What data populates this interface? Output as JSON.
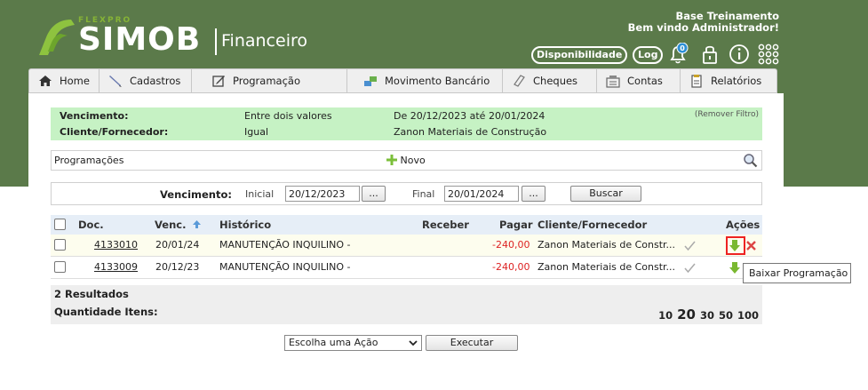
{
  "header": {
    "logo_sub": "FLEXPRO",
    "logo_main": "SIMOB",
    "logo_module": "Financeiro",
    "welcome_line1": "Base Treinamento",
    "welcome_line2": "Bem vindo Administrador!",
    "disponibilidade_label": "Disponibilidade",
    "log_label": "Log",
    "notification_count": "0"
  },
  "nav": [
    {
      "label": "Home",
      "icon": "home-icon"
    },
    {
      "label": "Cadastros",
      "icon": "pencil-icon"
    },
    {
      "label": "Programação",
      "icon": "edit-icon"
    },
    {
      "label": "Movimento Bancário",
      "icon": "bank-transfer-icon"
    },
    {
      "label": "Cheques",
      "icon": "cheque-icon"
    },
    {
      "label": "Contas",
      "icon": "accounts-icon"
    },
    {
      "label": "Relatórios",
      "icon": "report-icon"
    }
  ],
  "filter": {
    "label1": "Vencimento:",
    "op1": "Entre dois valores",
    "val1": "De 20/12/2023 até 20/01/2024",
    "label2": "Cliente/Fornecedor:",
    "op2": "Igual",
    "val2": "Zanon Materiais de Construção",
    "remove": "(Remover Filtro)"
  },
  "programacoes": {
    "title": "Programações",
    "novo": "Novo"
  },
  "search": {
    "label": "Vencimento:",
    "inicial_label": "Inicial",
    "inicial_value": "20/12/2023",
    "final_label": "Final",
    "final_value": "20/01/2024",
    "dots": "...",
    "buscar": "Buscar"
  },
  "table": {
    "headers": {
      "doc": "Doc.",
      "venc": "Venc.",
      "historico": "Histórico",
      "receber": "Receber",
      "pagar": "Pagar",
      "cliente": "Cliente/Fornecedor",
      "acoes": "Ações"
    },
    "rows": [
      {
        "doc": "4133010",
        "venc": "20/01/24",
        "historico": "MANUTENÇÃO INQUILINO -",
        "receber": "",
        "pagar": "-240,00",
        "cliente": "Zanon Materiais de Constr..."
      },
      {
        "doc": "4133009",
        "venc": "20/12/23",
        "historico": "MANUTENÇÃO INQUILINO -",
        "receber": "",
        "pagar": "-240,00",
        "cliente": "Zanon Materiais de Constr..."
      }
    ]
  },
  "footer": {
    "results": "2 Resultados",
    "qty_label": "Quantidade Itens:",
    "pages": [
      "10",
      "20",
      "30",
      "50",
      "100"
    ]
  },
  "actions": {
    "select_value": "Escolha uma Ação",
    "executar": "Executar"
  },
  "tooltip": "Baixar Programação",
  "colors": {
    "header_green": "#5b7a4a",
    "filter_bg": "#c6f2c4",
    "negative": "#dd2222"
  }
}
